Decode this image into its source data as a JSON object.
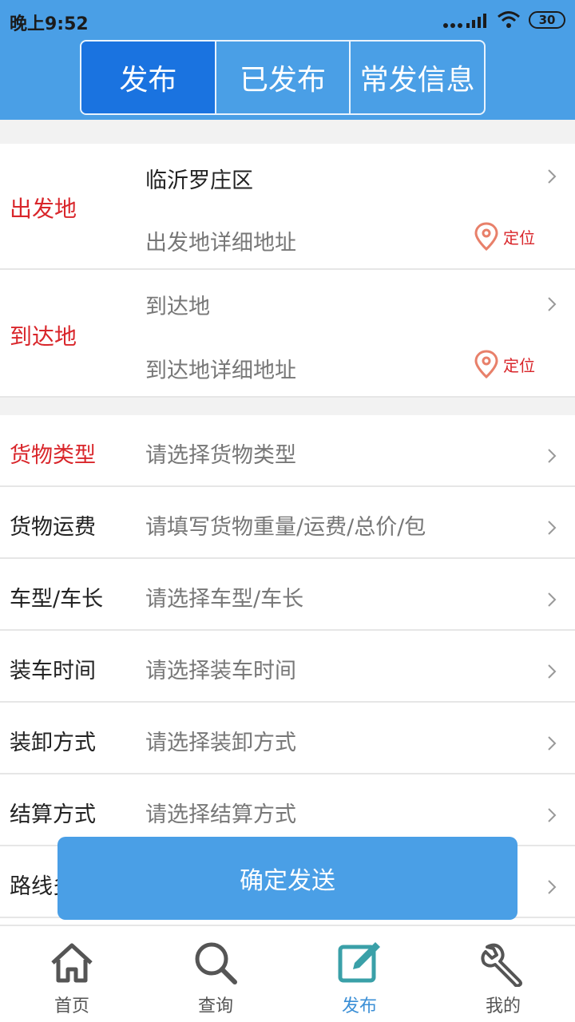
{
  "status_bar": {
    "time": "晚上9:52",
    "battery": "30"
  },
  "tabs": [
    {
      "label": "发布",
      "active": true
    },
    {
      "label": "已发布",
      "active": false
    },
    {
      "label": "常发信息",
      "active": false
    }
  ],
  "origin": {
    "label": "出发地",
    "city": "临沂罗庄区",
    "detail_placeholder": "出发地详细地址",
    "locate_label": "定位"
  },
  "destination": {
    "label": "到达地",
    "city_placeholder": "到达地",
    "detail_placeholder": "到达地详细地址",
    "locate_label": "定位"
  },
  "fields": [
    {
      "label": "货物类型",
      "placeholder": "请选择货物类型",
      "required": true
    },
    {
      "label": "货物运费",
      "placeholder": "请填写货物重量/运费/总价/包",
      "required": false
    },
    {
      "label": "车型/车长",
      "placeholder": "请选择车型/车长",
      "required": false
    },
    {
      "label": "装车时间",
      "placeholder": "请选择装车时间",
      "required": false
    },
    {
      "label": "装卸方式",
      "placeholder": "请选择装卸方式",
      "required": false
    },
    {
      "label": "结算方式",
      "placeholder": "请选择结算方式",
      "required": false
    },
    {
      "label": "路线多",
      "placeholder": "",
      "required": false
    }
  ],
  "submit_label": "确定发送",
  "bottom_nav": [
    {
      "label": "首页",
      "icon": "home-icon",
      "active": false
    },
    {
      "label": "查询",
      "icon": "search-icon",
      "active": false
    },
    {
      "label": "发布",
      "icon": "edit-icon",
      "active": true
    },
    {
      "label": "我的",
      "icon": "wrench-icon",
      "active": false
    }
  ],
  "colors": {
    "header_blue": "#4a9fe6",
    "active_tab": "#1a73e0",
    "required_red": "#d9262b",
    "nav_active": "#3b8fd6"
  }
}
